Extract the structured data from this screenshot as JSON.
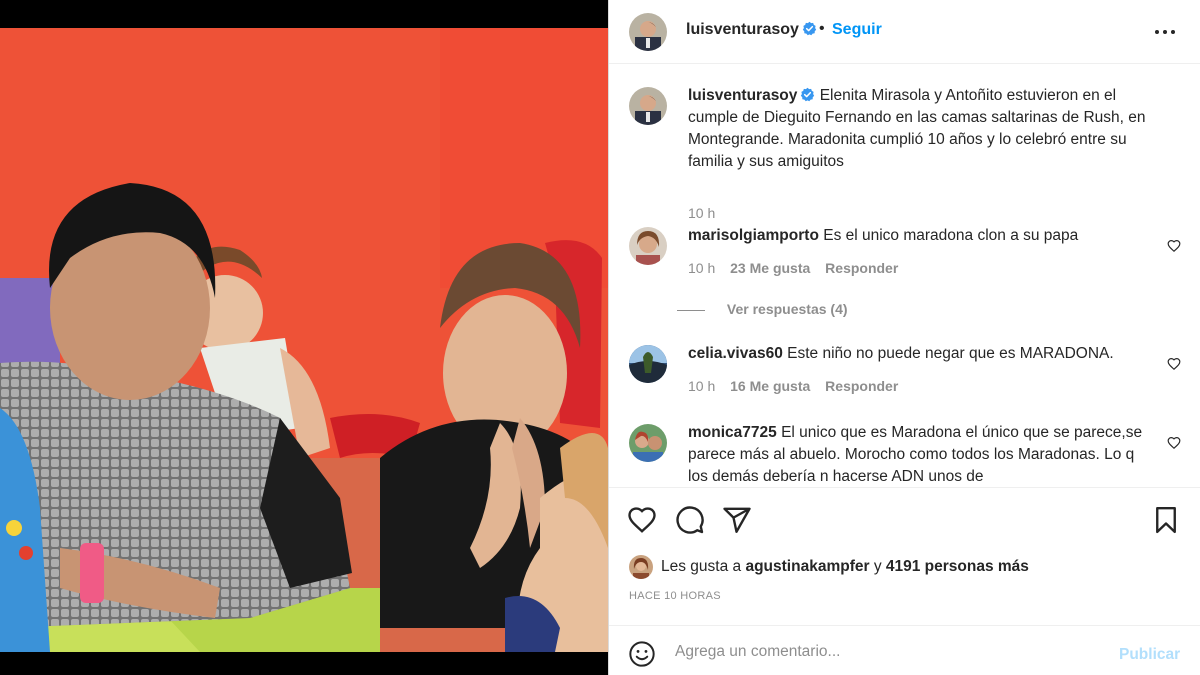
{
  "post": {
    "author": "luisventurasoy",
    "verified": true,
    "separator": "•",
    "follow_label": "Seguir",
    "more_icon": "more-options-icon",
    "caption": "Elenita Mirasola y Antoñito estuvieron en el cumple de Dieguito Fernando en las camas saltarinas de Rush, en Montegrande. Maradonita cumplió 10 años y lo celebró entre su familia y sus amiguitos",
    "caption_time": "10 h"
  },
  "comments": [
    {
      "user": "marisolgiamporto",
      "text": "Es el unico maradona clon a su papa",
      "time": "10 h",
      "likes": "23 Me gusta",
      "reply_label": "Responder",
      "replies_label": "Ver respuestas (4)"
    },
    {
      "user": "celia.vivas60",
      "text": "Este niño no puede negar que es MARADONA.",
      "time": "10 h",
      "likes": "16 Me gusta",
      "reply_label": "Responder"
    },
    {
      "user": "monica7725",
      "text": "El unico que es Maradona el único que se parece,se parece más al abuelo. Morocho como todos los Maradonas. Lo q los demás debería n hacerse ADN unos de"
    }
  ],
  "actions": {
    "icons": [
      "heart-icon",
      "comment-icon",
      "share-icon",
      "bookmark-icon"
    ]
  },
  "likes": {
    "prefix": "Les gusta a",
    "user": "agustinakampfer",
    "joiner": "y",
    "others": "4191 personas más"
  },
  "timestamp": "HACE 10 HORAS",
  "composer": {
    "placeholder": "Agrega un comentario...",
    "publish_label": "Publicar"
  },
  "colors": {
    "link_blue": "#0095f6",
    "publish_disabled": "#b2dffc",
    "verified_blue": "#3897f0",
    "secondary_text": "#8e8e8e"
  }
}
